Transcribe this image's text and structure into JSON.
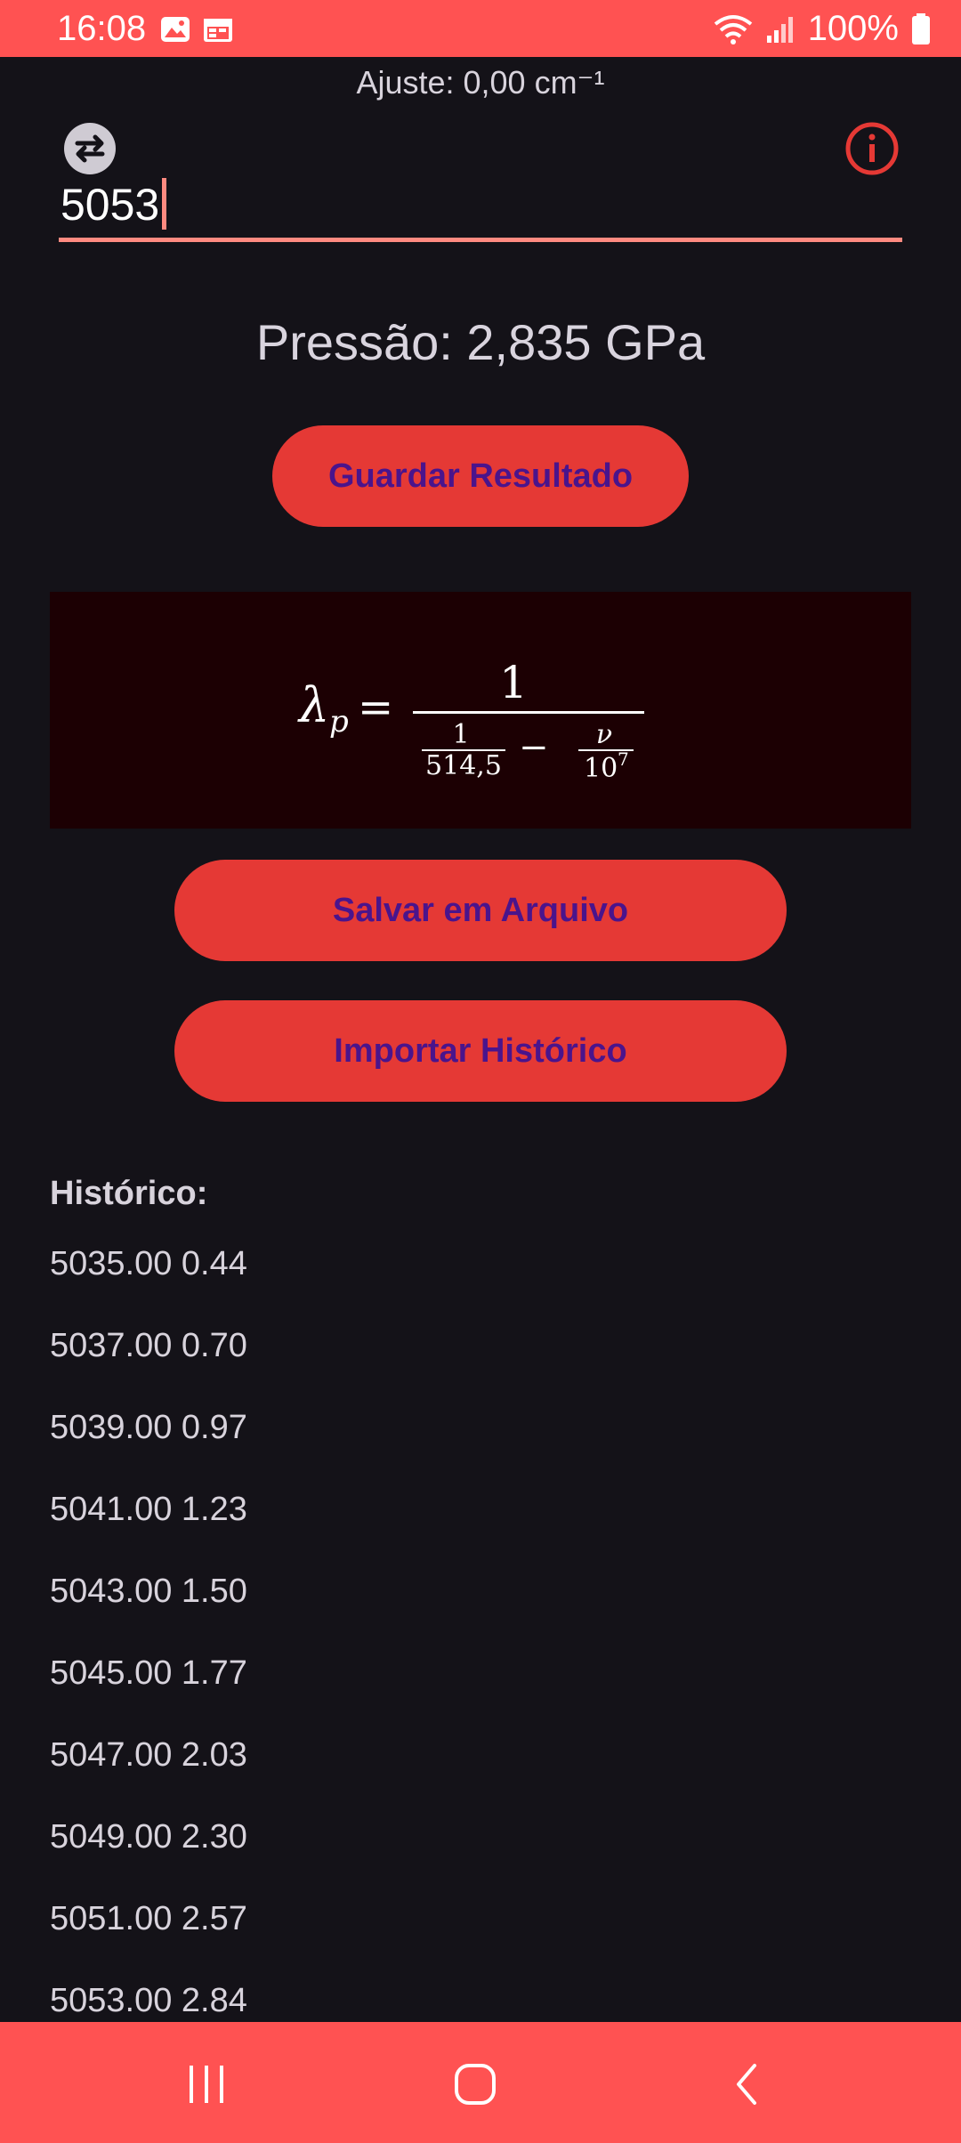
{
  "status_bar": {
    "time": "16:08",
    "battery": "100%",
    "icons": [
      "gallery-icon",
      "calendar-icon",
      "wifi-icon",
      "signal-icon",
      "battery-icon"
    ]
  },
  "adjust_label": "Ajuste: 0,00 cm⁻¹",
  "input": {
    "value": "5053",
    "icons": {
      "left": "swap-icon",
      "right": "info-icon"
    },
    "accent": "#ff8a80"
  },
  "pressure_label": "Pressão: 2,835 GPa",
  "buttons": {
    "guardar": "Guardar Resultado",
    "salvar": "Salvar em Arquivo",
    "importar": "Importar Histórico",
    "fill_color": "#e53935",
    "text_color": "#4a148c"
  },
  "formula": {
    "lhs": "λ",
    "lhs_sub": "p",
    "equals": "=",
    "numerator": "1",
    "inner_num": "1",
    "inner_den": "514,5",
    "minus": "−",
    "nu": "ν",
    "ten": "10",
    "exp": "7"
  },
  "history": {
    "title": "Histórico:",
    "items": [
      "5035.00 0.44",
      "5037.00 0.70",
      "5039.00 0.97",
      "5041.00 1.23",
      "5043.00 1.50",
      "5045.00 1.77",
      "5047.00 2.03",
      "5049.00 2.30",
      "5051.00 2.57",
      "5053.00 2.84"
    ]
  },
  "nav": {
    "icons": [
      "recent-apps-icon",
      "home-icon",
      "back-icon"
    ]
  }
}
